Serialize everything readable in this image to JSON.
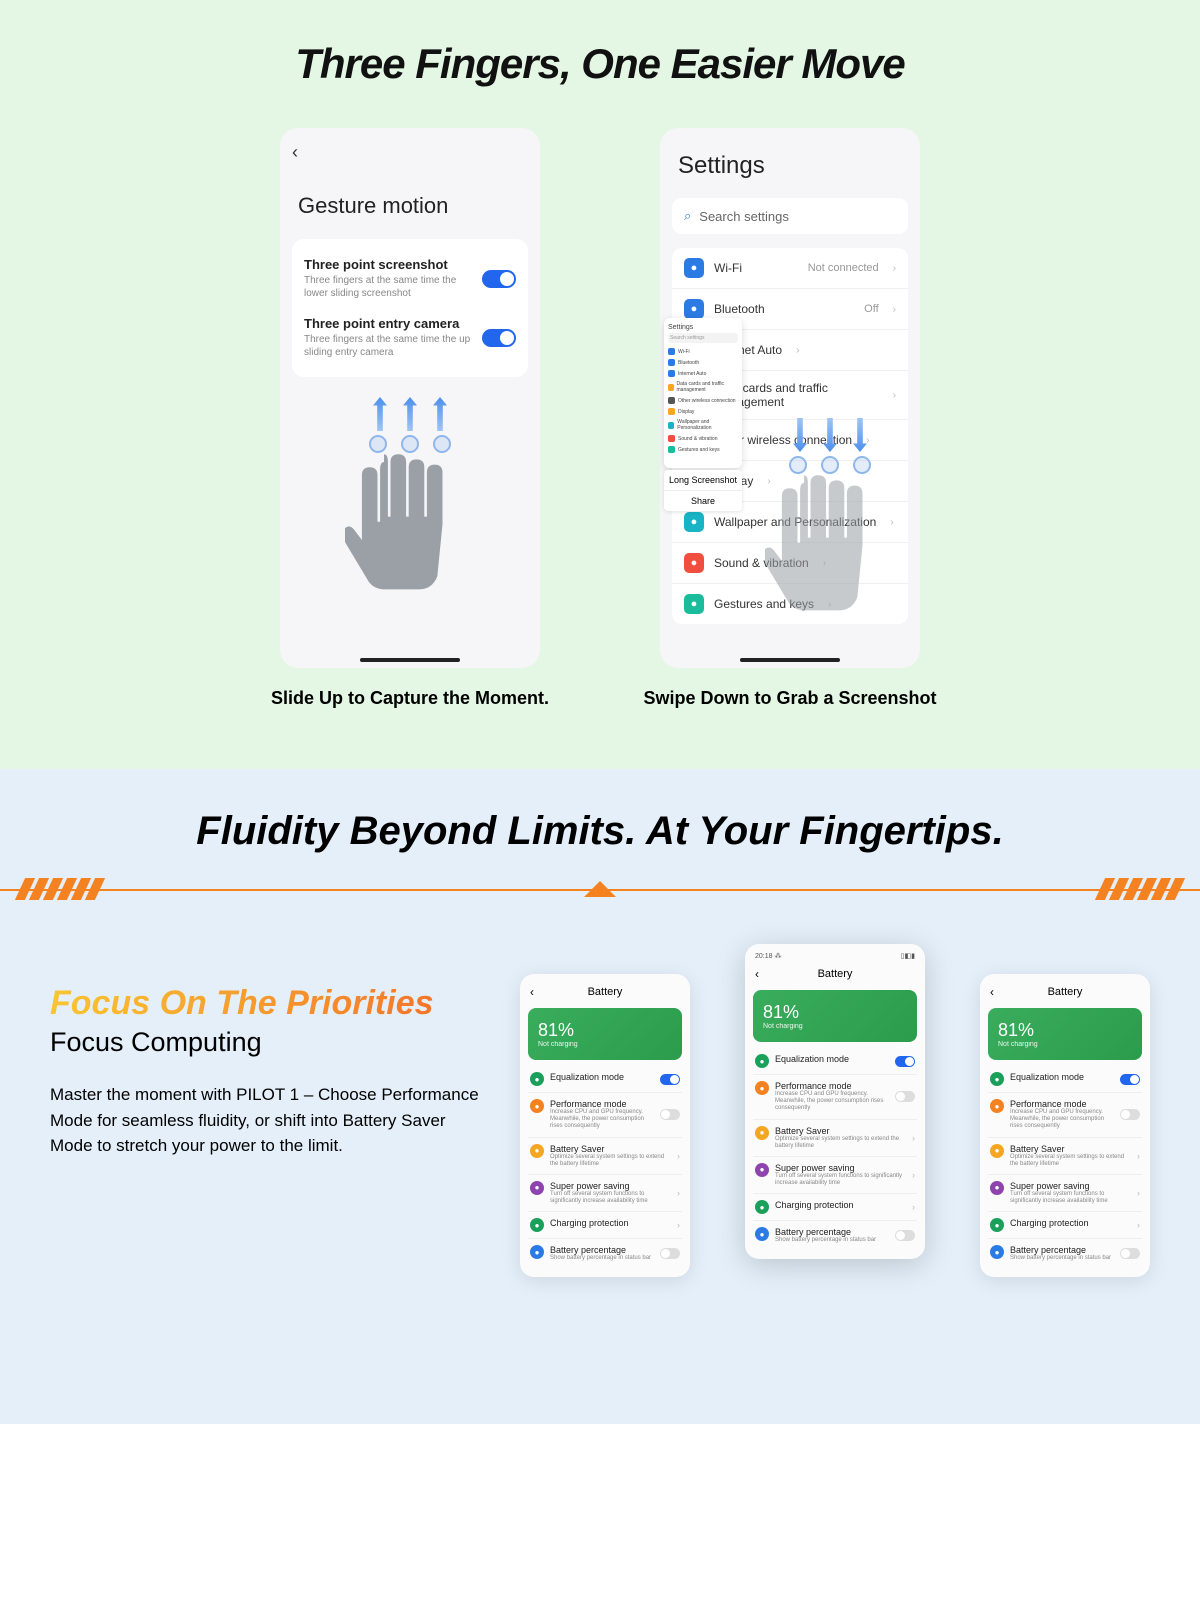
{
  "section1": {
    "title": "Three Fingers, One Easier Move",
    "phone1": {
      "header": "Gesture motion",
      "items": [
        {
          "label": "Three point screenshot",
          "desc": "Three fingers at the same time the lower sliding screenshot",
          "toggle": true
        },
        {
          "label": "Three point entry camera",
          "desc": "Three fingers at the same time the up sliding entry camera",
          "toggle": true
        }
      ],
      "caption": "Slide Up to Capture the Moment."
    },
    "phone2": {
      "header": "Settings",
      "search_placeholder": "Search settings",
      "items": [
        {
          "icon_bg": "#2c7be5",
          "label": "Wi-Fi",
          "value": "Not connected"
        },
        {
          "icon_bg": "#2c7be5",
          "label": "Bluetooth",
          "value": "Off"
        },
        {
          "icon_bg": "#2c7be5",
          "label": "Internet Auto",
          "value": ""
        },
        {
          "icon_bg": "#f5a623",
          "label": "Data cards and traffic management",
          "value": ""
        },
        {
          "icon_bg": "#555",
          "label": "Other wireless connection",
          "value": ""
        },
        {
          "icon_bg": "#f5a623",
          "label": "Display",
          "value": ""
        },
        {
          "icon_bg": "#18b3c4",
          "label": "Wallpaper and Personalization",
          "value": ""
        },
        {
          "icon_bg": "#f04e3e",
          "label": "Sound & vibration",
          "value": ""
        },
        {
          "icon_bg": "#1abc9c",
          "label": "Gestures and keys",
          "value": ""
        }
      ],
      "mini": {
        "title": "Settings",
        "search": "Search settings",
        "rows": [
          "Wi-Fi",
          "Bluetooth",
          "Internet Auto",
          "Data cards and traffic management",
          "Other wireless connection",
          "Display",
          "Wallpaper and Personalization",
          "Sound & vibration",
          "Gestures and keys"
        ]
      },
      "actions": [
        "Long Screenshot",
        "Share"
      ],
      "caption": "Swipe Down to Grab a Screenshot"
    }
  },
  "section2": {
    "title": "Fluidity Beyond Limits. At Your Fingertips.",
    "focus_title": "Focus On The Priorities",
    "focus_sub": "Focus Computing",
    "focus_body": "Master the moment with PILOT 1 – Choose Performance Mode for seamless fluidity, or shift into Battery Saver Mode to stretch your power to the limit.",
    "battery": {
      "status_time": "20:18",
      "header": "Battery",
      "pct": "81%",
      "pct_sub": "Not charging",
      "rows": [
        {
          "ic": "#1aa05a",
          "label": "Equalization mode",
          "desc": "",
          "ctrl": "toggle_on"
        },
        {
          "ic": "#f58220",
          "label": "Performance mode",
          "desc": "Increase CPU and GPU frequency. Meanwhile, the power consumption rises consequently",
          "ctrl": "toggle_off"
        },
        {
          "ic": "#f5a623",
          "label": "Battery Saver",
          "desc": "Optimize several system settings to extend the battery lifetime",
          "ctrl": "chev"
        },
        {
          "ic": "#8e44ad",
          "label": "Super power saving",
          "desc": "Turn off several system functions to significantly increase availability time",
          "ctrl": "chev"
        },
        {
          "ic": "#1aa05a",
          "label": "Charging protection",
          "desc": "",
          "ctrl": "chev"
        },
        {
          "ic": "#2c7be5",
          "label": "Battery percentage",
          "desc": "Show battery percentage in status bar",
          "ctrl": "toggle_off"
        }
      ]
    }
  }
}
